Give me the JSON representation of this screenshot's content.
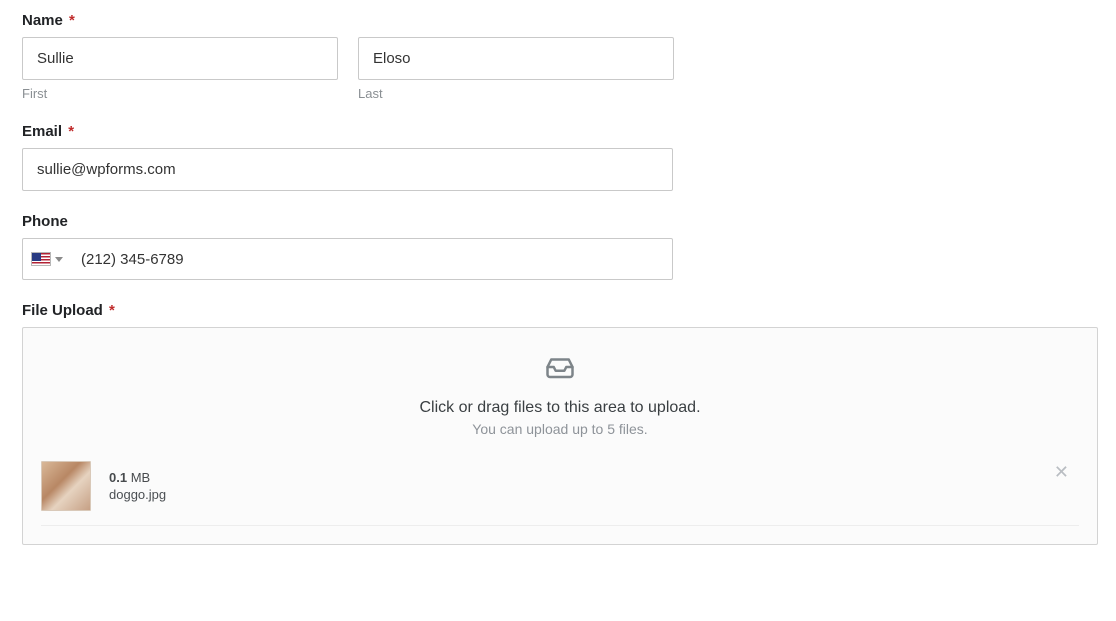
{
  "name": {
    "label": "Name",
    "required": "*",
    "first_value": "Sullie",
    "first_sublabel": "First",
    "last_value": "Eloso",
    "last_sublabel": "Last"
  },
  "email": {
    "label": "Email",
    "required": "*",
    "value": "sullie@wpforms.com"
  },
  "phone": {
    "label": "Phone",
    "country": "us",
    "value": "(212) 345-6789"
  },
  "upload": {
    "label": "File Upload",
    "required": "*",
    "text1": "Click or drag files to this area to upload.",
    "text2": "You can upload up to 5 files.",
    "file": {
      "size_num": "0.1",
      "size_unit": " MB",
      "name": "doggo.jpg"
    }
  }
}
